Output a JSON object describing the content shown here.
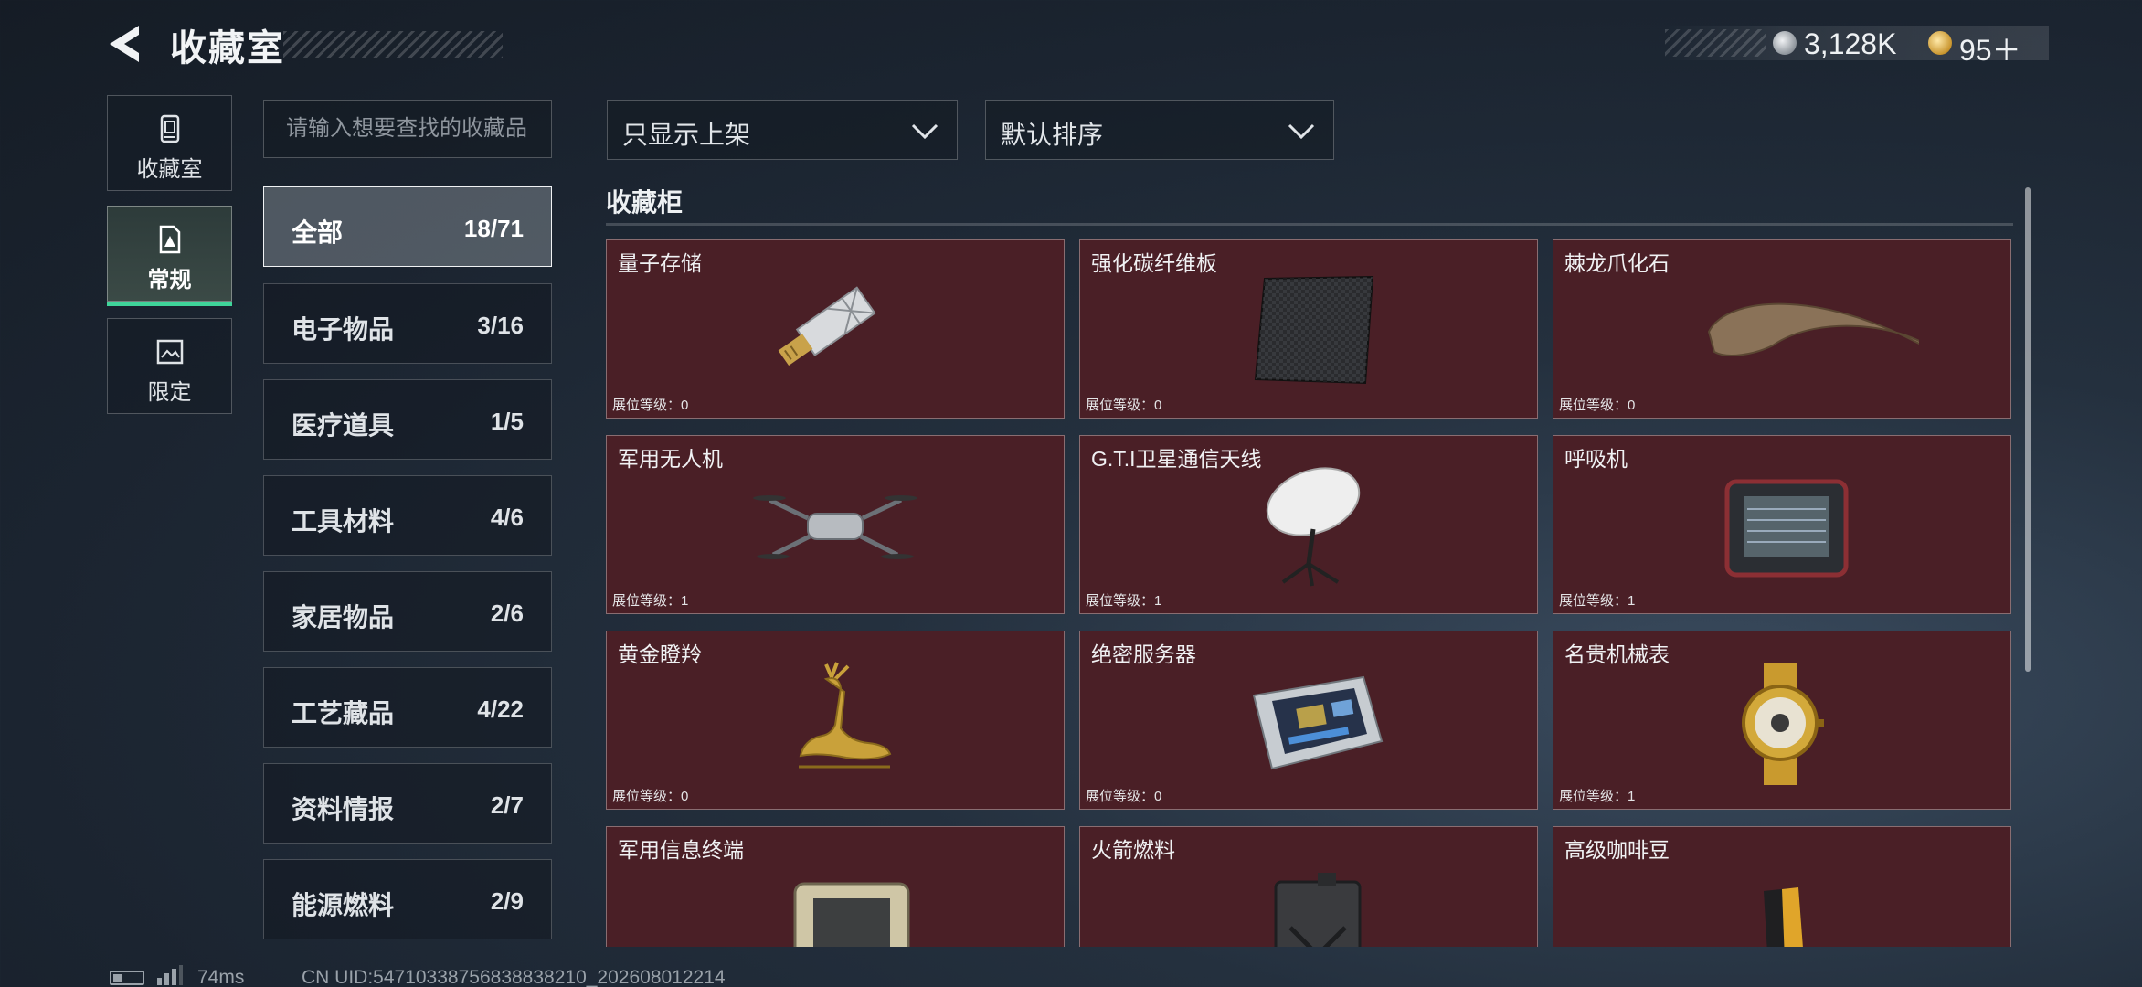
{
  "header": {
    "title": "收藏室",
    "currency": {
      "silver_value": "3,128K",
      "gold_value": "95＋"
    }
  },
  "rail": {
    "tabs": [
      {
        "label": "收藏室",
        "icon": "collection-room-icon",
        "active": false
      },
      {
        "label": "常规",
        "icon": "regular-icon",
        "active": true
      },
      {
        "label": "限定",
        "icon": "limited-icon",
        "active": false
      }
    ]
  },
  "search": {
    "placeholder": "请输入想要查找的收藏品"
  },
  "categories": [
    {
      "name": "全部",
      "count": "18/71",
      "active": true
    },
    {
      "name": "电子物品",
      "count": "3/16"
    },
    {
      "name": "医疗道具",
      "count": "1/5"
    },
    {
      "name": "工具材料",
      "count": "4/6"
    },
    {
      "name": "家居物品",
      "count": "2/6"
    },
    {
      "name": "工艺藏品",
      "count": "4/22"
    },
    {
      "name": "资料情报",
      "count": "2/7"
    },
    {
      "name": "能源燃料",
      "count": "2/9"
    }
  ],
  "filters": {
    "display": "只显示上架",
    "sort": "默认排序"
  },
  "section": {
    "title": "收藏柜"
  },
  "items": [
    {
      "name": "量子存储",
      "level": "展位等级：0",
      "icon": "usb-drive-icon"
    },
    {
      "name": "强化碳纤维板",
      "level": "展位等级：0",
      "icon": "carbon-plate-icon"
    },
    {
      "name": "棘龙爪化石",
      "level": "展位等级：0",
      "icon": "claw-fossil-icon"
    },
    {
      "name": "军用无人机",
      "level": "展位等级：1",
      "icon": "drone-icon"
    },
    {
      "name": "G.T.I卫星通信天线",
      "level": "展位等级：1",
      "icon": "satellite-dish-icon"
    },
    {
      "name": "呼吸机",
      "level": "展位等级：1",
      "icon": "ventilator-icon"
    },
    {
      "name": "黄金瞪羚",
      "level": "展位等级：0",
      "icon": "golden-gazelle-icon"
    },
    {
      "name": "绝密服务器",
      "level": "展位等级：0",
      "icon": "server-icon"
    },
    {
      "name": "名贵机械表",
      "level": "展位等级：1",
      "icon": "watch-icon"
    },
    {
      "name": "军用信息终端",
      "level": "",
      "icon": "terminal-icon"
    },
    {
      "name": "火箭燃料",
      "level": "",
      "icon": "fuel-can-icon"
    },
    {
      "name": "高级咖啡豆",
      "level": "",
      "icon": "coffee-bag-icon"
    }
  ],
  "footer": {
    "ping": "74ms",
    "uid": "CN UID:54710338756838838210_202608012214"
  }
}
